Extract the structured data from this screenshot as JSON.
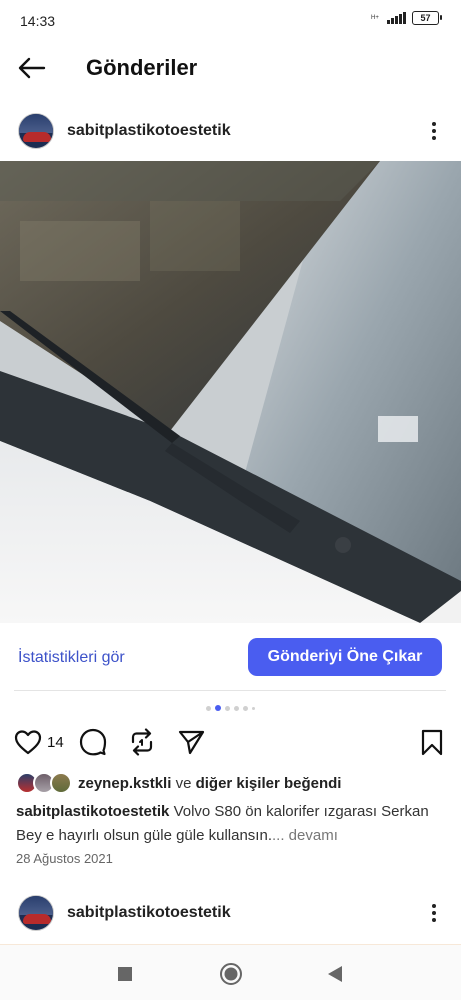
{
  "status_bar": {
    "time": "14:33",
    "network": "H+",
    "battery": "57"
  },
  "top_bar": {
    "back_icon": "arrow-left-icon",
    "title": "Gönderiler"
  },
  "post": {
    "username": "sabitplastikotoestetik",
    "more_icon": "more-vertical-icon",
    "image_description_icon": "car-windshield-photo",
    "stats_link": "İstatistikleri gör",
    "promote_button": "Gönderiyi Öne Çıkar",
    "carousel": {
      "count": 6,
      "active_index": 1
    },
    "like_count": "14",
    "liked_by_user": "zeynep.kstkli",
    "liked_by_connector": "ve",
    "liked_by_others": "diğer kişiler beğendi",
    "caption_user": "sabitplastikotoestetik",
    "caption_text": "Volvo S80 ön kalorifer ızgarası Serkan Bey e hayırlı olsun güle güle kullansın.",
    "caption_more": "... devamı",
    "date": "28 Ağustos 2021"
  },
  "next_post": {
    "username": "sabitplastikotoestetik"
  },
  "colors": {
    "accent": "#4a5df0",
    "link": "#3d52c9"
  }
}
